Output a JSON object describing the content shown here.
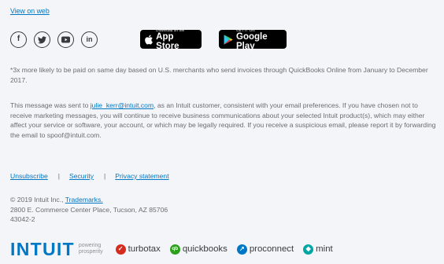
{
  "header": {
    "view_on_web": "View on web"
  },
  "social": [
    {
      "name": "facebook-icon",
      "glyph": "f"
    },
    {
      "name": "twitter-icon",
      "glyph": "t"
    },
    {
      "name": "youtube-icon",
      "glyph": "▶"
    },
    {
      "name": "linkedin-icon",
      "glyph": "in"
    }
  ],
  "stores": {
    "app_store": {
      "small": "Download on the",
      "big": "App Store"
    },
    "google_play": {
      "small": "GET IT ON",
      "big": "Google Play"
    }
  },
  "footnote": "*3x more likely to be paid on same day based on U.S. merchants who send invoices through QuickBooks Online from January to December 2017.",
  "message": {
    "before": "This message was sent to ",
    "email": "julie_kerr@intuit.com",
    "after": ", as an Intuit customer, consistent with your email preferences. If you have chosen not to receive marketing messages, you will continue to receive business communications about your selected Intuit product(s), which may either affect your service or software, your account, or which may be legally required. If you receive a suspicious email, please report it by forwarding the email to spoof@intuit.com."
  },
  "links": {
    "unsubscribe": "Unsubscribe",
    "security": "Security",
    "privacy": "Privacy statement",
    "separator": "|"
  },
  "copyright": {
    "line1": "© 2019 Intuit Inc., ",
    "trademarks": "Trademarks.",
    "line2": "2800 E. Commerce Center Place, Tucson, AZ 85706",
    "line3": "43042-2"
  },
  "brand": {
    "intuit": "INTUIT",
    "powering_1": "powering",
    "powering_2": "prosperity",
    "products": {
      "turbotax": "turbotax",
      "quickbooks": "quickbooks",
      "proconnect": "proconnect",
      "mint": "mint"
    }
  },
  "colors": {
    "link": "#0077c5",
    "turbotax": "#d52b1e",
    "quickbooks": "#2ca01c",
    "proconnect": "#0077c5",
    "mint": "#00a6a4"
  }
}
